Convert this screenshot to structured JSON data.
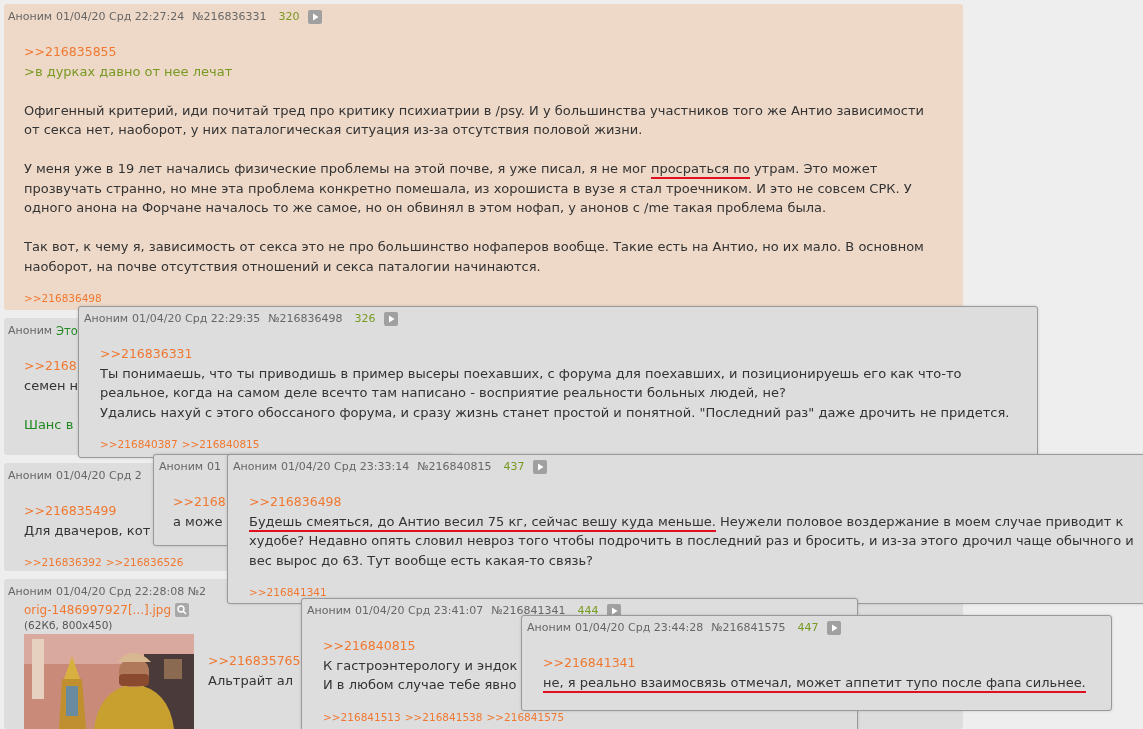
{
  "posts": [
    {
      "highlighted": true,
      "header": {
        "name": "Аноним",
        "date": "01/04/20 Срд 22:27:24",
        "number": "№216836331",
        "count": "320"
      },
      "blocks": [
        {
          "kind": "link",
          "text": ">>216835855"
        },
        {
          "kind": "quote",
          "text": ">в дурках давно от нее лечат"
        },
        {
          "kind": "text",
          "lines": [
            {
              "segments": [
                {
                  "text": "Офигенный критерий, иди почитай тред про критику психиатрии в /psy. И у большинства участников того же Антио зависимости от секса нет, наоборот, у них паталогическая ситуация из-за отсутствия половой жизни.",
                  "underlined": false
                }
              ]
            }
          ]
        },
        {
          "kind": "text",
          "lines": [
            {
              "segments": [
                {
                  "text": "У меня уже в 19 лет начались физические проблемы на этой почве, я уже писал, я не мог ",
                  "underlined": false
                },
                {
                  "text": "просраться по",
                  "underlined": true
                },
                {
                  "text": " утрам. Это может прозвучать странно, но мне эта проблема конкретно помешала, из хорошиста в вузе я стал троечником. И это не совсем СРК. У одного анона на Форчане началось то же самое, но он обвинял в этом нофап, у анонов с /me такая проблема была.",
                  "underlined": false
                }
              ]
            }
          ]
        },
        {
          "kind": "text",
          "lines": [
            {
              "segments": [
                {
                  "text": "Так вот, к чему я, зависимость от секса это не про большинство нофаперов вообще. Такие есть на Антио, но их мало. В основном наоборот, на почве отсутствия отношений и секса паталогии начинаются.",
                  "underlined": false
                }
              ]
            }
          ]
        }
      ],
      "replies": [
        ">>216836498"
      ]
    },
    {
      "highlighted": false,
      "header": {
        "name": "Аноним",
        "subject": "Это"
      },
      "blocks": [
        {
          "kind": "link",
          "text": ">>2168"
        },
        {
          "kind": "text",
          "lines": [
            {
              "segments": [
                {
                  "text": "семен н",
                  "underlined": false
                }
              ]
            }
          ]
        },
        {
          "kind": "green",
          "text": "Шанс в"
        }
      ]
    },
    {
      "highlighted": false,
      "header": {
        "name": "Аноним",
        "date": "01/04/20 Срд 2"
      },
      "blocks": [
        {
          "kind": "link",
          "text": ">>216835499"
        },
        {
          "kind": "text",
          "lines": [
            {
              "segments": [
                {
                  "text": "Для двачеров, кот",
                  "underlined": false
                }
              ]
            }
          ]
        }
      ],
      "replies": [
        ">>216836392",
        ">>216836526"
      ]
    },
    {
      "highlighted": false,
      "header": {
        "name": "Аноним",
        "date": "01/04/20 Срд 22:28:08 №2"
      },
      "file": {
        "name": "orig-1486997927[...].jpg",
        "info": "(62Кб, 800x450)"
      },
      "blocks": [
        {
          "kind": "link",
          "text": ">>216835765"
        },
        {
          "kind": "text",
          "lines": [
            {
              "segments": [
                {
                  "text": "Альтрайт ал",
                  "underlined": false
                }
              ]
            }
          ]
        }
      ]
    }
  ],
  "popups": [
    {
      "header": {
        "name": "Аноним",
        "date": "01/04/20 Срд 22:29:35",
        "number": "№216836498",
        "count": "326"
      },
      "blocks": [
        {
          "kind": "link",
          "text": ">>216836331"
        },
        {
          "kind": "text",
          "lines": [
            {
              "segments": [
                {
                  "text": "Ты понимаешь, что ты приводишь в пример высеры поехавших, с форума для поехавших, и позиционируешь его как что-то реальное, когда на самом деле всечто там написано - восприятие реальности больных людей, не?",
                  "underlined": false
                }
              ]
            },
            {
              "segments": [
                {
                  "text": "Удались нахуй с этого обоссаного форума, и сразу жизнь станет простой и понятной. \"Последний раз\" даже дрочить не придется.",
                  "underlined": false
                }
              ]
            }
          ]
        }
      ],
      "replies": [
        ">>216840387",
        ">>216840815"
      ]
    },
    {
      "header": {
        "name": "Аноним",
        "date": "01"
      },
      "blocks": [
        {
          "kind": "link",
          "text": ">>2168"
        },
        {
          "kind": "text",
          "lines": [
            {
              "segments": [
                {
                  "text": "а може",
                  "underlined": false
                }
              ]
            }
          ]
        }
      ]
    },
    {
      "header": {
        "name": "Аноним",
        "date": "01/04/20 Срд 23:33:14",
        "number": "№216840815",
        "count": "437"
      },
      "blocks": [
        {
          "kind": "link",
          "text": ">>216836498"
        },
        {
          "kind": "text",
          "lines": [
            {
              "segments": [
                {
                  "text": "Будешь смеяться, до Антио весил 75 кг, сейчас вешу куда меньше.",
                  "underlined": true
                },
                {
                  "text": " Неужели половое воздержание в моем случае приводит к худобе? Недавно опять словил невроз того чтобы подрочить в последний раз и бросить, и из-за этого дрочил чаще обычного и вес вырос до 63. Тут вообще есть какая-то связь?",
                  "underlined": false
                }
              ]
            }
          ]
        }
      ],
      "replies": [
        ">>216841341"
      ]
    },
    {
      "header": {
        "name": "Аноним",
        "date": "01/04/20 Срд 23:41:07",
        "number": "№216841341",
        "count": "444"
      },
      "blocks": [
        {
          "kind": "link",
          "text": ">>216840815"
        },
        {
          "kind": "text",
          "lines": [
            {
              "segments": [
                {
                  "text": "К гастроэнтерологу и эндок",
                  "underlined": false
                }
              ]
            },
            {
              "segments": [
                {
                  "text": "И в любом случае тебе явно",
                  "underlined": false
                }
              ]
            }
          ]
        }
      ],
      "replies": [
        ">>216841513",
        ">>216841538",
        ">>216841575"
      ]
    },
    {
      "header": {
        "name": "Аноним",
        "date": "01/04/20 Срд 23:44:28",
        "number": "№216841575",
        "count": "447"
      },
      "blocks": [
        {
          "kind": "link",
          "text": ">>216841341"
        },
        {
          "kind": "text",
          "lines": [
            {
              "segments": [
                {
                  "text": "не, я реально взаимосвязь отмечал, может аппетит тупо после фапа сильнее.",
                  "underlined": true
                }
              ]
            }
          ]
        }
      ]
    }
  ]
}
